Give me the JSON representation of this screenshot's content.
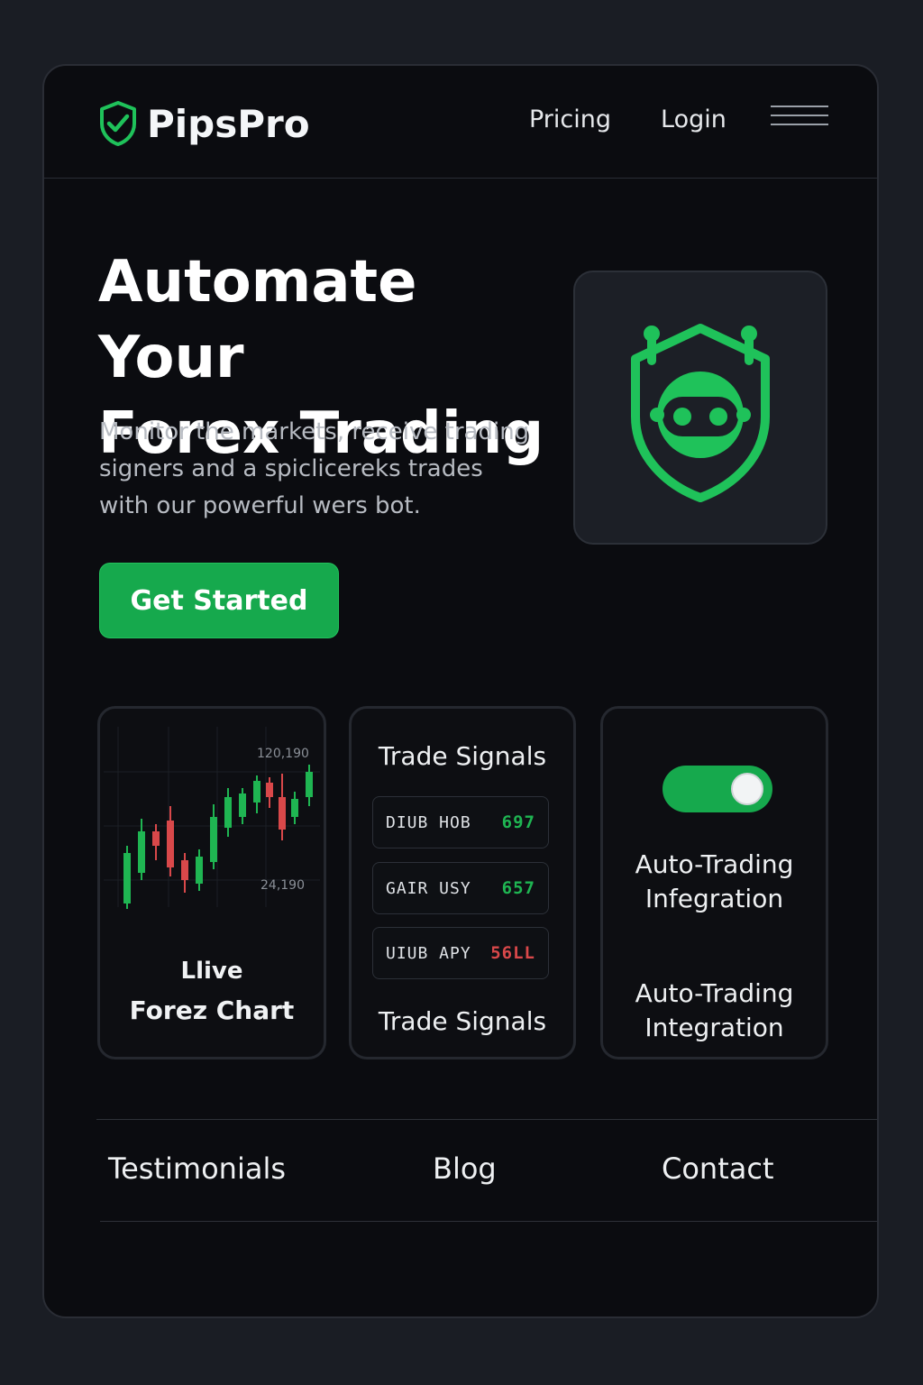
{
  "header": {
    "brand": "PipsPro",
    "nav": {
      "pricing": "Pricing",
      "login": "Login"
    }
  },
  "hero": {
    "title_line1": "Automate Your",
    "title_line2": "Forex Trading",
    "subtitle": "Monitor the markets, receive trading signers and a spiclicereks trades with our powerful wers bot.",
    "cta": "Get Started"
  },
  "cards": {
    "chart": {
      "price_high": "120,190",
      "price_low": "24,190",
      "caption_line1": "Llive",
      "caption_line2": "Forez Chart"
    },
    "signals": {
      "title_top": "Trade Signals",
      "title_bottom": "Trade Signals",
      "rows": [
        {
          "pair": "DIUB HOB",
          "value": "697",
          "color": "#1fb552"
        },
        {
          "pair": "GAIR USY",
          "value": "657",
          "color": "#1fb552"
        },
        {
          "pair": "UIUB APY",
          "value": "56LL",
          "color": "#d9484a"
        }
      ]
    },
    "auto": {
      "label_top": "Auto-Trading Infegration",
      "label_bottom": "Auto-Trading Integration",
      "toggle_on": true
    }
  },
  "footer": {
    "testimonials": "Testimonials",
    "blog": "Blog",
    "contact": "Contact"
  },
  "colors": {
    "accent": "#16a94d",
    "up": "#1fb552",
    "down": "#d9484a",
    "background": "#0b0c10"
  }
}
